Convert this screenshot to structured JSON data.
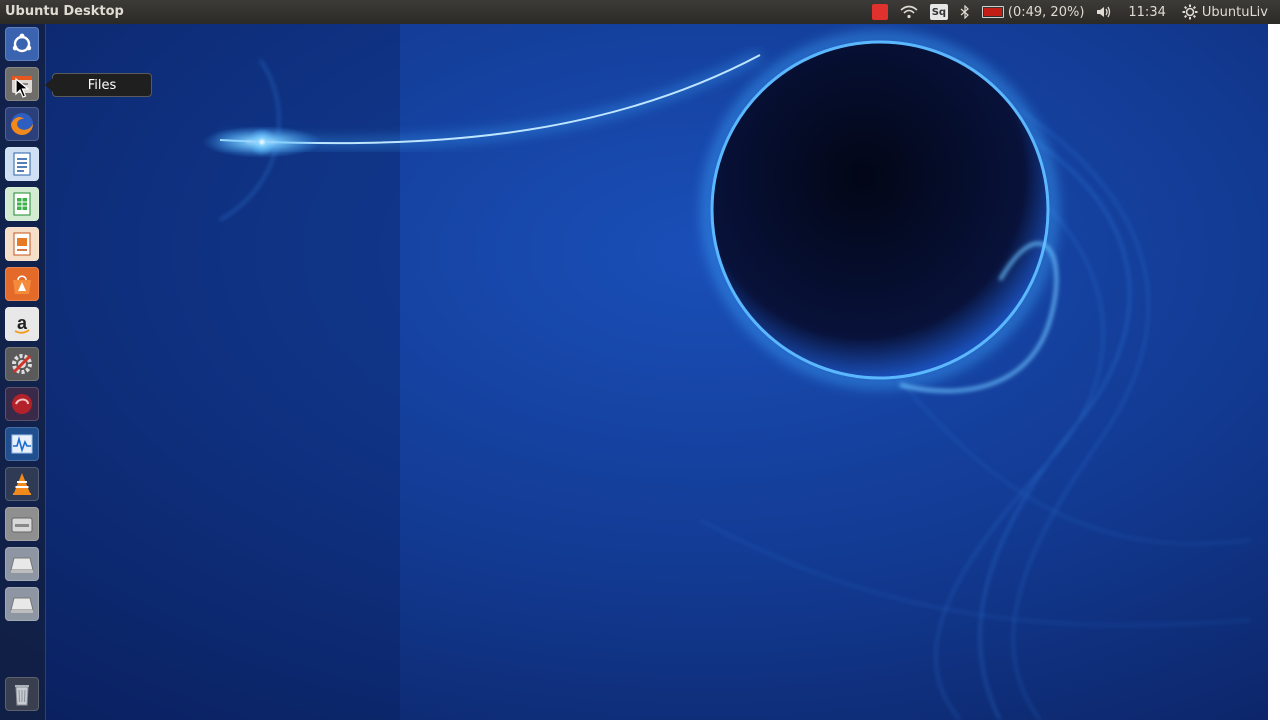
{
  "top_panel": {
    "title": "Ubuntu Desktop",
    "indicators": {
      "screen_recorder_icon": "record-icon",
      "wifi_icon": "wifi-icon",
      "squeeze_label": "Sq",
      "bluetooth_icon": "bluetooth-icon",
      "battery_text": "(0:49, 20%)",
      "volume_icon": "volume-icon",
      "clock": "11:34",
      "session_icon": "gear-icon",
      "user": "UbuntuLiv"
    }
  },
  "launcher": {
    "items": [
      {
        "name": "Dash",
        "icon": "ubuntu-logo-icon"
      },
      {
        "name": "Files",
        "icon": "files-icon"
      },
      {
        "name": "Firefox",
        "icon": "firefox-icon"
      },
      {
        "name": "LibreOffice Writer",
        "icon": "writer-icon"
      },
      {
        "name": "LibreOffice Calc",
        "icon": "calc-icon"
      },
      {
        "name": "LibreOffice Impress",
        "icon": "impress-icon"
      },
      {
        "name": "Ubuntu Software",
        "icon": "software-center-icon"
      },
      {
        "name": "Amazon",
        "icon": "amazon-icon"
      },
      {
        "name": "System Settings",
        "icon": "settings-icon"
      },
      {
        "name": "App",
        "icon": "red-app-icon"
      },
      {
        "name": "System Monitor",
        "icon": "system-monitor-icon"
      },
      {
        "name": "VLC",
        "icon": "vlc-icon"
      },
      {
        "name": "Drive",
        "icon": "drive-icon"
      },
      {
        "name": "Disk",
        "icon": "disk-icon"
      },
      {
        "name": "Disk",
        "icon": "disk-icon"
      },
      {
        "name": "Trash",
        "icon": "trash-icon"
      }
    ]
  },
  "tooltip": {
    "text": "Files"
  },
  "colors": {
    "panel": "#3c3b37",
    "wallpaper_base": "#0d2a6e",
    "glow": "#3fa9ff"
  }
}
